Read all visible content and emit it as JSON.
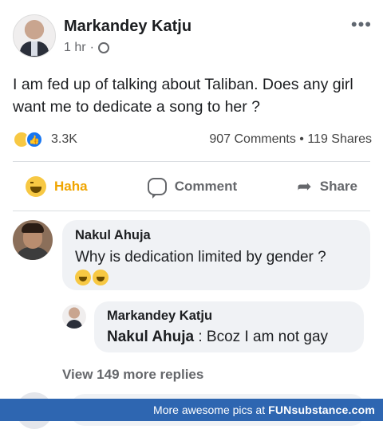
{
  "post": {
    "author": "Markandey Katju",
    "time": "1 hr",
    "separator": "·",
    "text": "I am fed up of talking about Taliban. Does any girl want me to dedicate a song to her ?",
    "reaction_count": "3.3K",
    "comments_shares": "907 Comments • 119 Shares",
    "actions": {
      "haha": "Haha",
      "comment": "Comment",
      "share": "Share"
    },
    "more_icon": "more-options-icon"
  },
  "comments": [
    {
      "author": "Nakul Ahuja",
      "text": "Why is dedication limited by gender ?"
    },
    {
      "author": "Markandey Katju",
      "mention": "Nakul Ahuja",
      "text": " : Bcoz I am not gay"
    }
  ],
  "view_more": "View 149 more replies",
  "footer": {
    "text": "More awesome pics at",
    "brand": "FUNsubstance.com"
  },
  "colors": {
    "haha": "#f0a500",
    "like": "#1877f2",
    "footer": "#2e66b1"
  }
}
